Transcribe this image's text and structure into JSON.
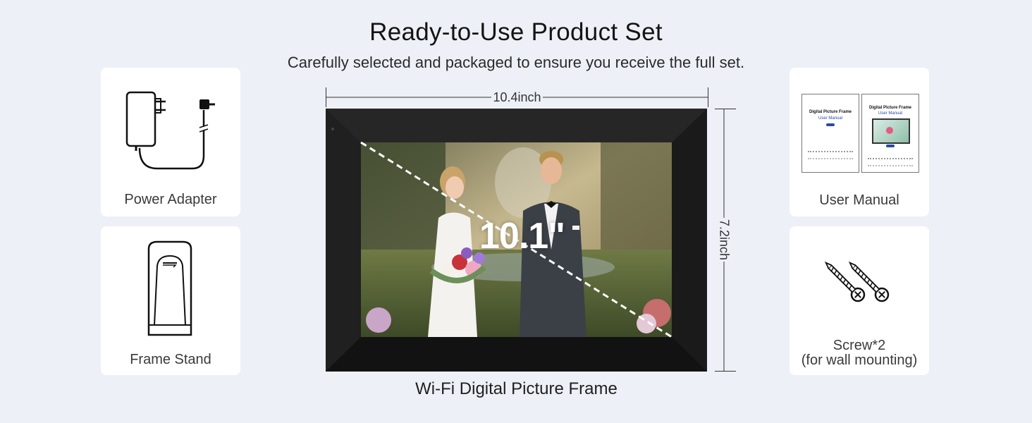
{
  "header": {
    "title": "Ready-to-Use Product Set",
    "subtitle": "Carefully selected and packaged to ensure you receive the full set."
  },
  "items": {
    "power_adapter": "Power Adapter",
    "frame_stand": "Frame Stand",
    "user_manual": "User Manual",
    "screw_line1": "Screw*2",
    "screw_line2": "(for wall mounting)"
  },
  "manual_pages": {
    "left_title": "Digital Picture Frame",
    "left_subtitle": "User Manual",
    "right_title": "Digital Picture Frame",
    "right_subtitle": "User Manual"
  },
  "frame": {
    "width_label": "10.4inch",
    "height_label": "7.2inch",
    "diagonal_label": "10.1\"",
    "product_name": "Wi-Fi Digital Picture Frame"
  },
  "colors": {
    "background": "#edf0f7",
    "card": "#ffffff",
    "frame_bezel": "#1c1c1c",
    "manual_accent": "#2b4aa0"
  }
}
